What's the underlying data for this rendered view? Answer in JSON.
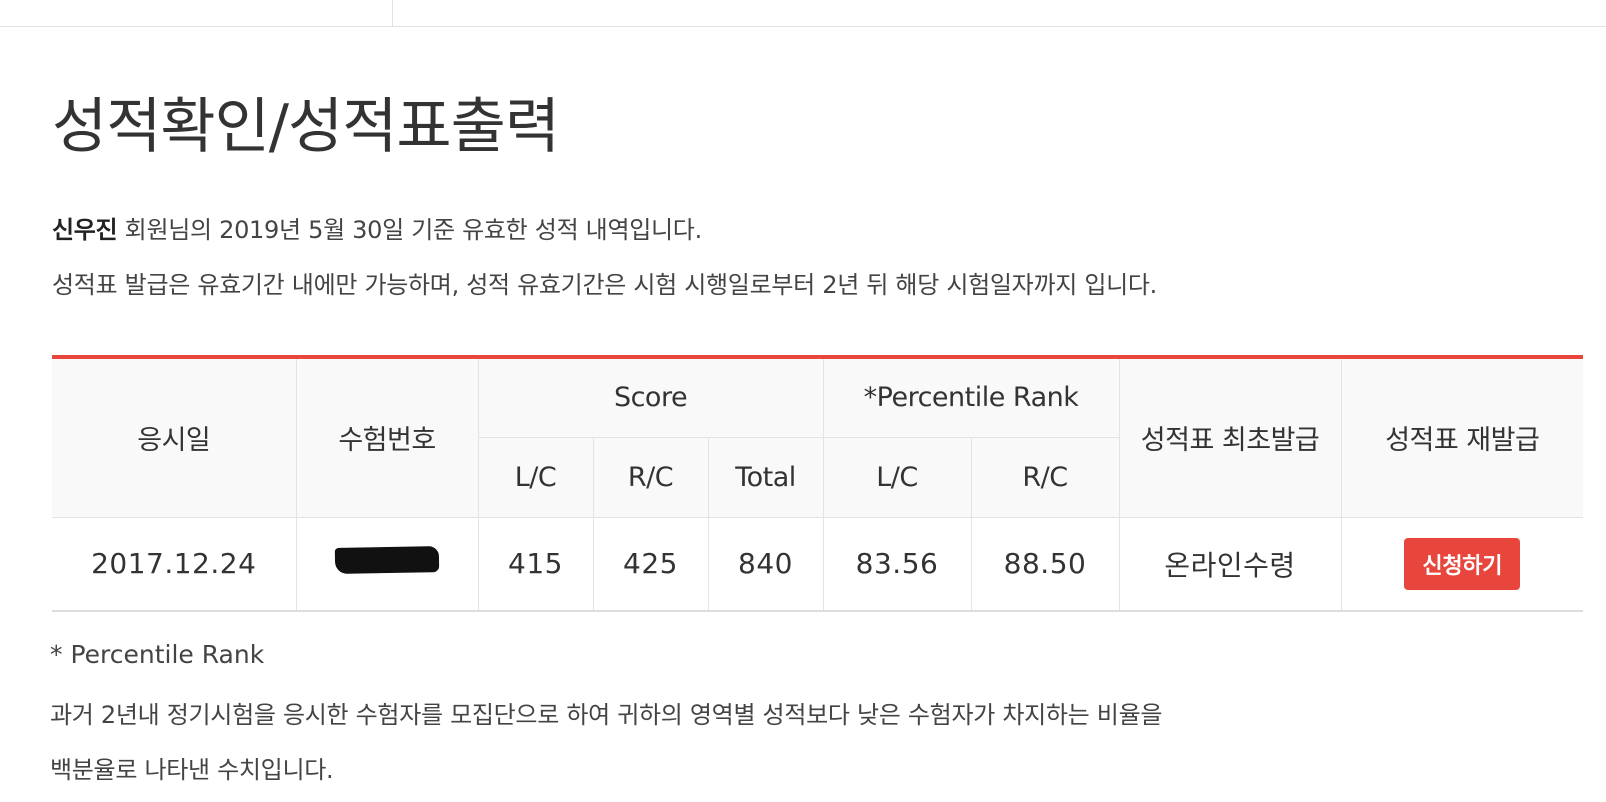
{
  "page": {
    "title": "성적확인/성적표출력"
  },
  "intro": {
    "member_name": "신우진",
    "line1_rest": " 회원님의 2019년 5월 30일 기준 유효한 성적 내역입니다.",
    "line2": "성적표 발급은 유효기간 내에만 가능하며, 성적 유효기간은 시험 시행일로부터 2년 뒤 해당 시험일자까지 입니다."
  },
  "table": {
    "headers": {
      "exam_date": "응시일",
      "exam_number": "수험번호",
      "score": "Score",
      "percentile_rank": "*Percentile Rank",
      "first_issue": "성적표 최초발급",
      "reissue": "성적표 재발급",
      "score_lc": "L/C",
      "score_rc": "R/C",
      "score_total": "Total",
      "pr_lc": "L/C",
      "pr_rc": "R/C"
    },
    "rows": [
      {
        "exam_date": "2017.12.24",
        "exam_number_redacted": true,
        "score_lc": "415",
        "score_rc": "425",
        "score_total": "840",
        "pr_lc": "83.56",
        "pr_rc": "88.50",
        "first_issue": "온라인수령",
        "reissue_button": "신청하기"
      }
    ]
  },
  "note": {
    "title": "* Percentile Rank",
    "line1": "과거 2년내 정기시험을 응시한 수험자를 모집단으로 하여 귀하의 영역별 성적보다 낮은 수험자가 차지하는 비율을",
    "line2": "백분율로 나타낸 수치입니다."
  },
  "colors": {
    "accent": "#e8453c",
    "header_bg": "#f9f9f9",
    "border": "#e3e3e3"
  }
}
